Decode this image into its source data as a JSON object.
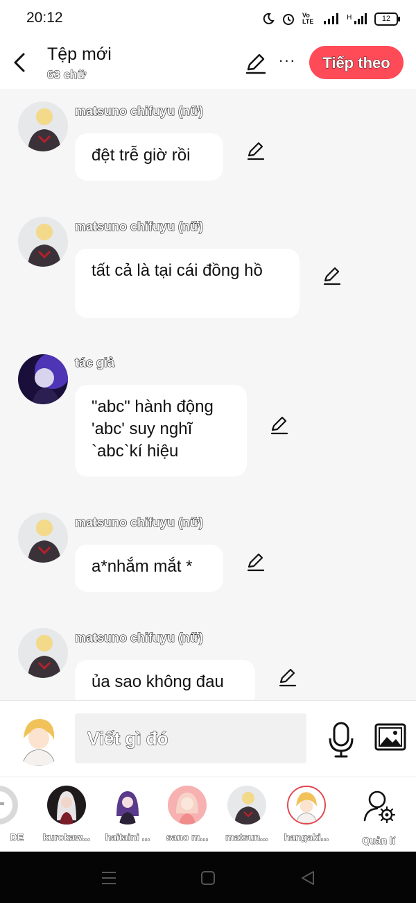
{
  "status_bar": {
    "time": "20:12",
    "battery": "12",
    "volte": "Vo LTE"
  },
  "header": {
    "title": "Tệp mới",
    "word_count": "63 chữ",
    "next_label": "Tiếp theo",
    "more_label": "···"
  },
  "messages": [
    {
      "sender": "matsuno chifuyu (nữ)",
      "text": "đệt trễ giờ rồi",
      "avatar": "chifuyu-avatar"
    },
    {
      "sender": "matsuno chifuyu (nữ)",
      "text": "tất cả là tại cái đồng hồ",
      "avatar": "chifuyu-avatar"
    },
    {
      "sender": "tác giả",
      "text": "\"abc\" hành động 'abc' suy nghĩ `abc`kí hiệu",
      "avatar": "author-avatar"
    },
    {
      "sender": "matsuno chifuyu (nữ)",
      "text": "a*nhắm mắt *",
      "avatar": "chifuyu-avatar"
    },
    {
      "sender": "matsuno chifuyu (nữ)",
      "text": "ủa sao không đau",
      "avatar": "chifuyu-avatar"
    }
  ],
  "input": {
    "placeholder": "Viết gì đó"
  },
  "characters": [
    {
      "name": "DE"
    },
    {
      "name": "kurokaw..."
    },
    {
      "name": "haitaini ..."
    },
    {
      "name": "sano m..."
    },
    {
      "name": "matsun..."
    },
    {
      "name": "hangaki..."
    },
    {
      "name": "Quản lí"
    }
  ],
  "colors": {
    "accent": "#ff4a57",
    "background": "#f6f6f6",
    "bubble": "#ffffff"
  }
}
